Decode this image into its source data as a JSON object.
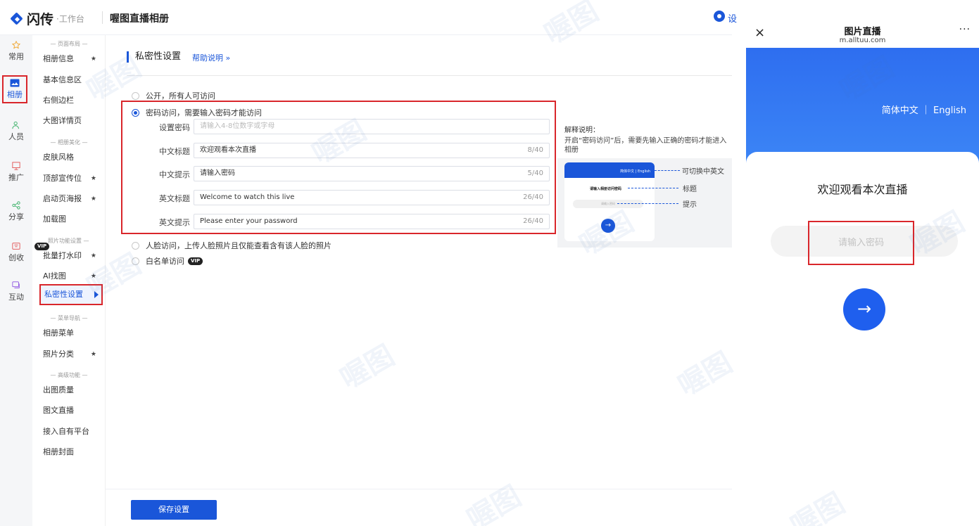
{
  "brand": {
    "name": "闪传",
    "sub": "·工作台"
  },
  "header": {
    "title": "喔图直播相册",
    "gear_text": "设"
  },
  "leftnav": [
    {
      "label": "常用"
    },
    {
      "label": "相册"
    },
    {
      "label": "人员"
    },
    {
      "label": "推广"
    },
    {
      "label": "分享"
    },
    {
      "label": "创收"
    },
    {
      "label": "互动"
    }
  ],
  "submenu": {
    "groups": [
      "— 页面布局 —",
      "— 相册美化 —",
      "照片功能设置 —",
      "— 菜单导航 —",
      "— 高级功能 —"
    ],
    "items": [
      {
        "label": "相册信息",
        "star": "★"
      },
      {
        "label": "基本信息区",
        "star": ""
      },
      {
        "label": "右侧边栏",
        "star": ""
      },
      {
        "label": "大图详情页",
        "star": ""
      },
      {
        "label": "皮肤风格",
        "star": ""
      },
      {
        "label": "顶部宣传位",
        "star": "★"
      },
      {
        "label": "启动页海报",
        "star": "★"
      },
      {
        "label": "加载图",
        "star": ""
      },
      {
        "label": "批量打水印",
        "star": "★"
      },
      {
        "label": "AI找图",
        "star": "★"
      },
      {
        "label": "私密性设置",
        "star": ""
      },
      {
        "label": "相册菜单",
        "star": ""
      },
      {
        "label": "照片分类",
        "star": "★"
      },
      {
        "label": "出图质量",
        "star": ""
      },
      {
        "label": "图文直播",
        "star": ""
      },
      {
        "label": "接入自有平台",
        "star": ""
      },
      {
        "label": "相册封面",
        "star": ""
      }
    ],
    "vip_label": "VIP"
  },
  "main": {
    "section_title": "私密性设置",
    "help_link": "帮助说明 »",
    "options": [
      {
        "label": "公开，所有人可访问",
        "selected": false
      },
      {
        "label": "密码访问，需要输入密码才能访问",
        "selected": true
      },
      {
        "label": "人脸访问，上传人脸照片且仅能查看含有该人脸的照片",
        "selected": false
      },
      {
        "label": "白名单访问",
        "selected": false
      }
    ],
    "fields": [
      {
        "label": "设置密码",
        "value": "",
        "placeholder": "请输入4-8位数字或字母",
        "count": ""
      },
      {
        "label": "中文标题",
        "value": "欢迎观看本次直播",
        "placeholder": "",
        "count": "8/40"
      },
      {
        "label": "中文提示",
        "value": "请输入密码",
        "placeholder": "",
        "count": "5/40"
      },
      {
        "label": "英文标题",
        "value": "Welcome to watch this live",
        "placeholder": "",
        "count": "26/40"
      },
      {
        "label": "英文提示",
        "value": "Please enter your password",
        "placeholder": "",
        "count": "26/40"
      }
    ],
    "explain_title": "解释说明：",
    "explain_desc": "开启“密码访问”后，需要先输入正确的密码才能进入相册",
    "explain_img": {
      "lang": "简体中文 | English",
      "title": "请输入相册访问密码",
      "placeholder": "请输入密码",
      "callouts": [
        "可切换中英文",
        "标题",
        "提示"
      ]
    },
    "save_label": "保存设置"
  },
  "phone": {
    "title": "图片直播",
    "url": "m.alltuu.com",
    "close": "×",
    "more": "···",
    "lang": "简体中文 ｜ English",
    "heading": "欢迎观看本次直播",
    "input_placeholder": "请输入密码",
    "go": "→"
  },
  "watermark": "喔图",
  "colors": {
    "accent": "#1a56d9",
    "highlight": "#d9262b"
  }
}
